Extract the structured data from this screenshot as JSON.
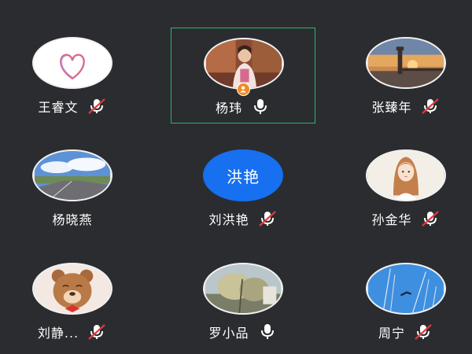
{
  "participants": [
    {
      "name": "王睿文",
      "mic": "muted",
      "avatar": "heart-icon"
    },
    {
      "name": "杨玮",
      "mic": "on",
      "avatar": "photo",
      "active": true,
      "host": true
    },
    {
      "name": "张臻年",
      "mic": "muted",
      "avatar": "photo-sunset-lighthouse"
    },
    {
      "name": "杨晓燕",
      "mic": "none",
      "avatar": "photo-road-sky"
    },
    {
      "name": "刘洪艳",
      "mic": "muted",
      "avatar": "text",
      "avatar_text": "洪艳",
      "avatar_color": "#1670f0"
    },
    {
      "name": "孙金华",
      "mic": "muted",
      "avatar": "cartoon-girl"
    },
    {
      "name": "刘静...",
      "mic": "muted",
      "avatar": "cartoon-bear"
    },
    {
      "name": "罗小品",
      "mic": "on",
      "avatar": "photo-tree"
    },
    {
      "name": "周宁",
      "mic": "muted",
      "avatar": "photo-branches-sky"
    }
  ],
  "colors": {
    "background": "#2b2c30",
    "active_border": "#2fb36a",
    "muted_slash": "#e03a3a",
    "host_badge": "#f08a24"
  }
}
